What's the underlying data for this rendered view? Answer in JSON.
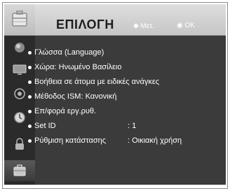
{
  "header": {
    "title": "ΕΠΙΛΟΓΗ",
    "hint_move": "Μετ.",
    "hint_ok": "OK",
    "icon": "settings-case-icon"
  },
  "sidebar": {
    "items": [
      {
        "icon": "picture-icon"
      },
      {
        "icon": "screen-icon"
      },
      {
        "icon": "audio-icon"
      },
      {
        "icon": "time-icon"
      },
      {
        "icon": "lock-icon"
      },
      {
        "icon": "option-case-icon",
        "active": true
      }
    ]
  },
  "menu": {
    "items": [
      {
        "label": "Γλώσσα (Language)"
      },
      {
        "label": "Χώρα: Ηνωμένο Βασίλειο"
      },
      {
        "label": "Βοήθεια σε άτομα με ειδικές ανάγκες"
      },
      {
        "label": "Μέθοδος ISM: Κανονική"
      },
      {
        "label": "Επ/φορά εργ.ρυθ."
      },
      {
        "label": "Set ID",
        "value": ": 1"
      },
      {
        "label": "Ρύθμιση κατάστασης",
        "value": ": Οικιακή χρήση"
      }
    ]
  },
  "colors": {
    "panel": "#3b3b3b",
    "sidebar": "#2b2b2b",
    "header": "#d0d0d0"
  }
}
